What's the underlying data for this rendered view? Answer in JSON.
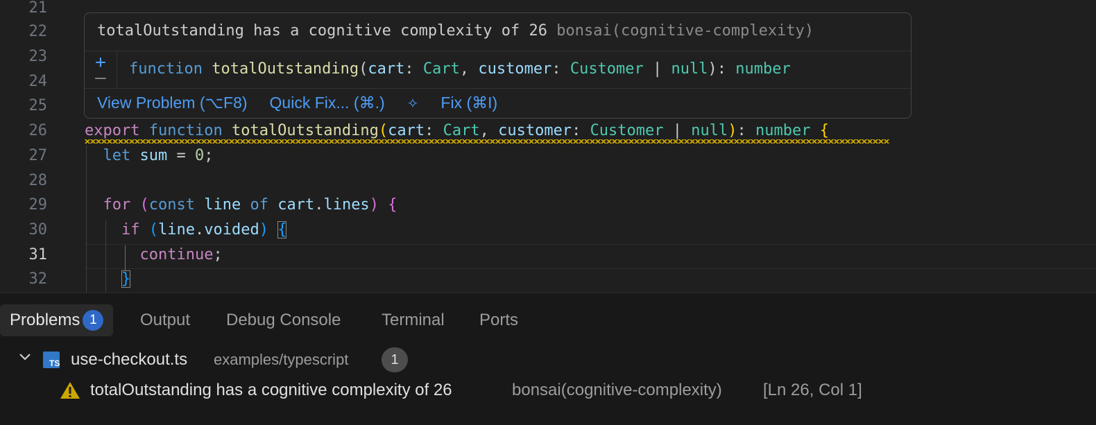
{
  "editor": {
    "line_numbers": [
      "21",
      "22",
      "23",
      "24",
      "25",
      "26",
      "27",
      "28",
      "29",
      "30",
      "31",
      "32"
    ],
    "active_line": "31",
    "code": {
      "l26": {
        "export": "export",
        "function": "function",
        "name": "totalOutstanding",
        "open": "(",
        "p1": "cart",
        "colon1": ": ",
        "t1": "Cart",
        "comma": ", ",
        "p2": "customer",
        "colon2": ": ",
        "t2": "Customer",
        "pipe": " | ",
        "nul": "null",
        "close": ")",
        "colon3": ": ",
        "ret": "number",
        "brace": "{"
      },
      "l27": {
        "let": "let",
        "var": "sum",
        "eq": " = ",
        "num": "0",
        "semi": ";"
      },
      "l29": {
        "for": "for",
        "open": "(",
        "const": "const",
        "var": "line",
        "of": "of",
        "obj": "cart",
        "dot": ".",
        "prop": "lines",
        "close": ")",
        "brace": "{"
      },
      "l30": {
        "if": "if",
        "open": "(",
        "obj": "line",
        "dot": ".",
        "prop": "voided",
        "close": ")",
        "brace": "{"
      },
      "l31": {
        "kw": "continue",
        "semi": ";"
      },
      "l32": {
        "brace": "}"
      }
    }
  },
  "hover": {
    "message": "totalOutstanding has a cognitive complexity of 26",
    "source": "bonsai(cognitive-complexity)",
    "plus_icon": "+",
    "minus_icon": "—",
    "signature": {
      "function": "function",
      "name": "totalOutstanding",
      "open": "(",
      "p1": "cart",
      "colon1": ": ",
      "t1": "Cart",
      "comma": ", ",
      "p2": "customer",
      "colon2": ": ",
      "t2": "Customer",
      "pipe": " | ",
      "nul": "null",
      "close": ")",
      "colon3": ": ",
      "ret": "number"
    },
    "actions": {
      "view_problem": "View Problem (⌥F8)",
      "quick_fix": "Quick Fix... (⌘.)",
      "fix_icon": "sparkle-icon",
      "fix": "Fix (⌘I)"
    }
  },
  "panel": {
    "tabs": [
      {
        "label": "Problems",
        "badge": "1"
      },
      {
        "label": "Output"
      },
      {
        "label": "Debug Console"
      },
      {
        "label": "Terminal"
      },
      {
        "label": "Ports"
      }
    ],
    "file": {
      "icon_text": "TS",
      "name": "use-checkout.ts",
      "path": "examples/typescript",
      "count": "1"
    },
    "problem": {
      "message": "totalOutstanding has a cognitive complexity of 26",
      "source": "bonsai(cognitive-complexity)",
      "location": "[Ln 26, Col 1]"
    }
  },
  "colors": {
    "warning": "#cca700",
    "accent": "#4d9df5",
    "badge": "#2f68c7"
  }
}
